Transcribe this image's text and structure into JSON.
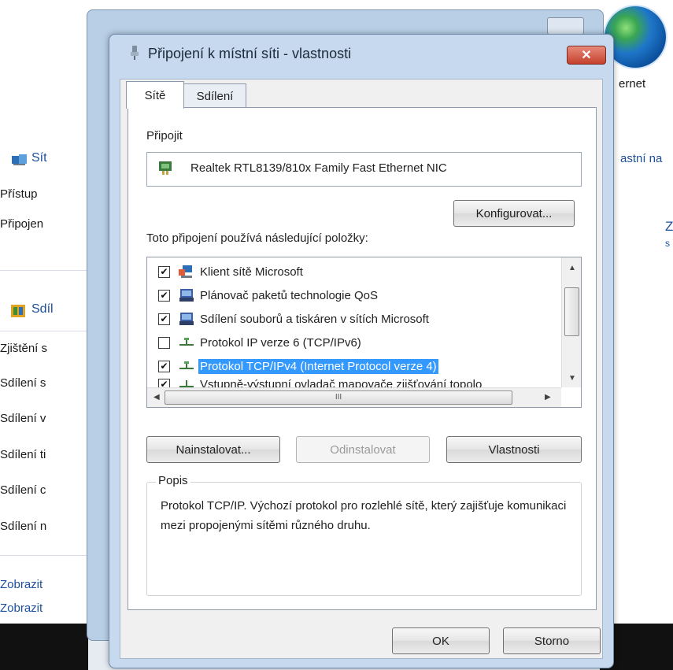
{
  "background": {
    "globe_label": "ernet",
    "sidebar_title": "Sít",
    "right_fragment": "astní na",
    "right_z": "Z",
    "right_s": "s",
    "left_items": [
      "Přístup",
      "Připojen"
    ],
    "section_title": "Sdíl",
    "section_items": [
      "Zjištění s",
      "Sdílení s",
      "Sdílení v",
      "Sdílení ti",
      "Sdílení c",
      "Sdílení n"
    ],
    "bottom_links": [
      "Zobrazit",
      "Zobrazit"
    ]
  },
  "dialog": {
    "title": "Připojení k místní síti - vlastnosti",
    "close_symbol": "✕",
    "tabs": [
      "Sítě",
      "Sdílení"
    ],
    "connect_label": "Připojit",
    "adapter_name": "Realtek RTL8139/810x Family Fast Ethernet NIC",
    "configure_button": "Konfigurovat...",
    "items_label": "Toto připojení používá následující položky:",
    "items": [
      {
        "label": "Klient sítě Microsoft",
        "checked": true
      },
      {
        "label": "Plánovač paketů technologie QoS",
        "checked": true
      },
      {
        "label": "Sdílení souborů a tiskáren v sítích Microsoft",
        "checked": true
      },
      {
        "label": "Protokol IP verze 6 (TCP/IPv6)",
        "checked": false
      },
      {
        "label": "Protokol TCP/IPv4 (Internet Protocol verze 4)",
        "checked": true
      },
      {
        "label": "Vstupně-výstupní ovladač mapovače zjišťování topolo",
        "checked": true
      }
    ],
    "hscroll_mark": "III",
    "install_button": "Nainstalovat...",
    "uninstall_button": "Odinstalovat",
    "properties_button": "Vlastnosti",
    "description_group": "Popis",
    "description_text": "Protokol TCP/IP. Výchozí protokol pro rozlehlé sítě, který zajišťuje komunikaci mezi propojenými sítěmi různého druhu.",
    "ok_button": "OK",
    "cancel_button": "Storno"
  },
  "colors": {
    "selection": "#3399ff",
    "close_red": "#c3412c",
    "frame_blue": "#c6d9ee"
  }
}
